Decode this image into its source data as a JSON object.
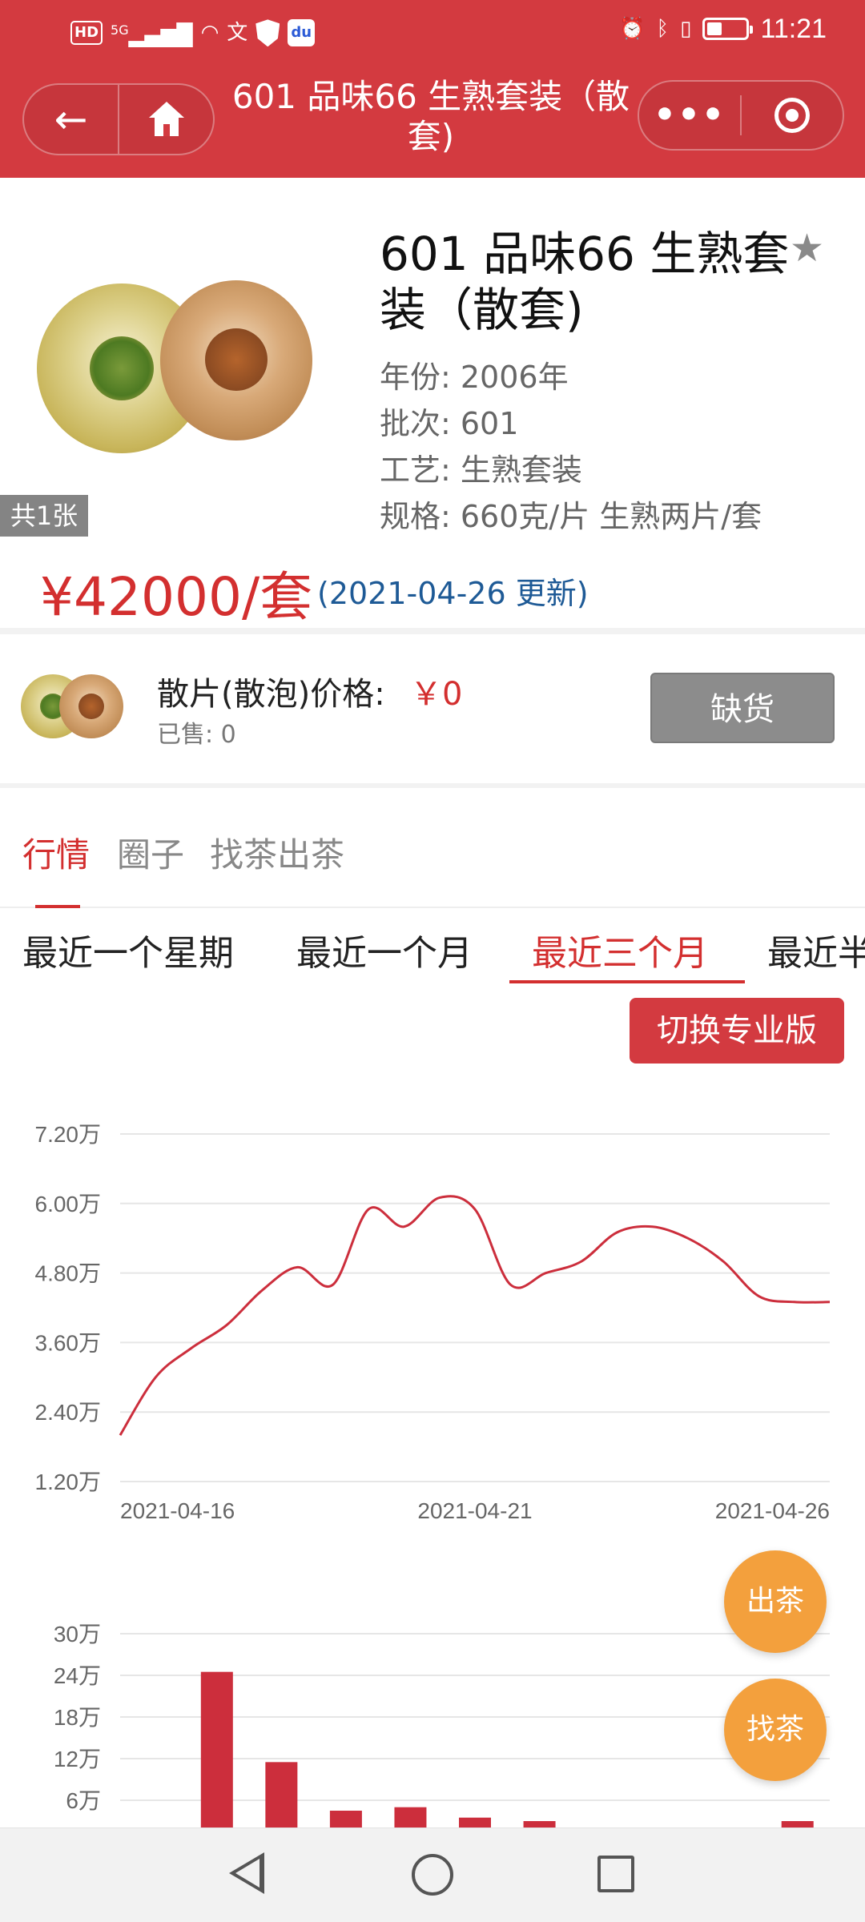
{
  "status_bar": {
    "network": "5G",
    "hd": "HD",
    "baidu": "du",
    "time": "11:21"
  },
  "header": {
    "title": "601 品味66 生熟套装（散套)"
  },
  "product": {
    "title": "601 品味66 生熟套装（散套)",
    "image_count": "共1张",
    "attrs": [
      "年份: 2006年",
      "批次: 601",
      "工艺: 生熟套装",
      "规格: 660克/片 生熟两片/套"
    ],
    "price": "¥42000/套",
    "updated": "(2021-04-26 更新)"
  },
  "loose": {
    "label": "散片(散泡)价格:",
    "price": "￥0",
    "sold": "已售: 0",
    "button": "缺货"
  },
  "tabs": [
    "行情",
    "圈子",
    "找茶出茶"
  ],
  "ranges": [
    "最近一个星期",
    "最近一个月",
    "最近三个月",
    "最近半"
  ],
  "pro_button": "切换专业版",
  "fabs": {
    "sell": "出茶",
    "find": "找茶"
  },
  "colors": {
    "brand_red": "#d33a40",
    "price_red": "#d32f2f",
    "fab_orange": "#f3a03d",
    "update_blue": "#1e5a96"
  },
  "chart_data": [
    {
      "type": "line",
      "y_ticks": [
        "7.20万",
        "6.00万",
        "4.80万",
        "3.60万",
        "2.40万",
        "1.20万"
      ],
      "ylim": [
        1.2,
        7.2
      ],
      "x_ticks": [
        "2021-04-16",
        "2021-04-21",
        "2021-04-26"
      ],
      "x": [
        0,
        0.5,
        1,
        1.5,
        2,
        2.5,
        3,
        3.5,
        4,
        4.5,
        5,
        5.5,
        6,
        6.5,
        7,
        7.5,
        8,
        8.5,
        9,
        9.5,
        10
      ],
      "values": [
        2.0,
        3.0,
        3.5,
        3.9,
        4.5,
        4.9,
        4.6,
        5.9,
        5.6,
        6.1,
        5.9,
        4.6,
        4.8,
        5.0,
        5.5,
        5.6,
        5.4,
        5.0,
        4.4,
        4.3,
        4.3
      ],
      "series_color": "#cc2e3c",
      "grid": true
    },
    {
      "type": "bar",
      "y_ticks": [
        "30万",
        "24万",
        "18万",
        "12万",
        "6万"
      ],
      "ylim": [
        0,
        30
      ],
      "values": [
        0,
        24.5,
        11.5,
        4.5,
        5,
        3.5,
        3,
        0,
        0,
        2,
        3
      ],
      "series_color": "#cc2e3c",
      "grid": true
    }
  ]
}
